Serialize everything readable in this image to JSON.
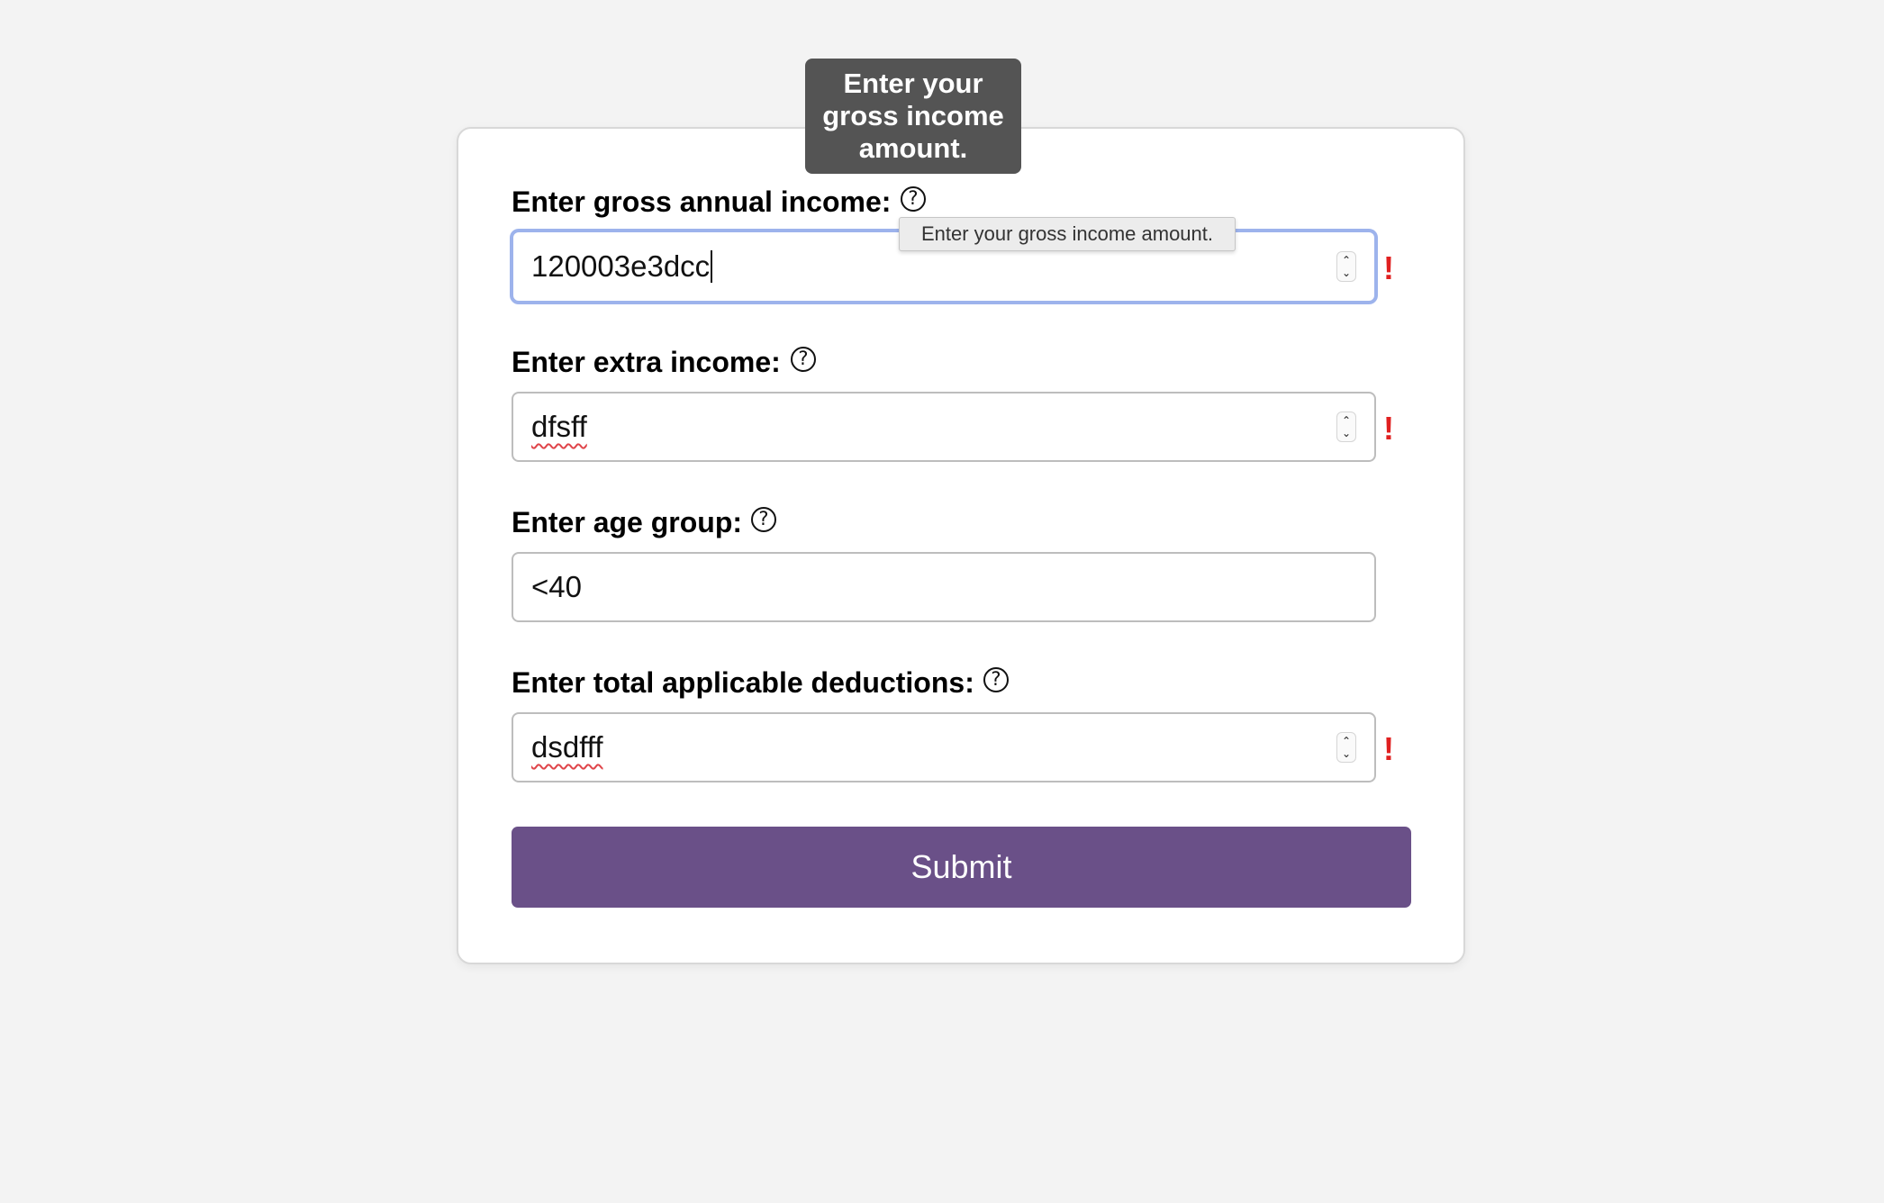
{
  "form": {
    "fields": [
      {
        "label": "Enter gross annual income:",
        "value": "120003e3dcc",
        "error": "!",
        "help_icon": "question-circle-icon"
      },
      {
        "label": "Enter extra income:",
        "value": "dfsff",
        "error": "!",
        "help_icon": "question-circle-icon"
      },
      {
        "label": "Enter age group:",
        "value": "<40",
        "help_icon": "question-circle-icon"
      },
      {
        "label": "Enter total applicable deductions:",
        "value": "dsdfff",
        "error": "!",
        "help_icon": "question-circle-icon"
      }
    ],
    "help_glyph": "?",
    "stepper_up": "⌃",
    "stepper_down": "⌄",
    "submit_label": "Submit"
  },
  "tooltips": {
    "custom": "Enter your gross income amount.",
    "native": "Enter your gross income amount."
  },
  "colors": {
    "background": "#f3f3f3",
    "submit": "#6a5088",
    "error": "#e02020",
    "focus_ring": "#9db3ec",
    "tooltip_dark": "#545454"
  }
}
